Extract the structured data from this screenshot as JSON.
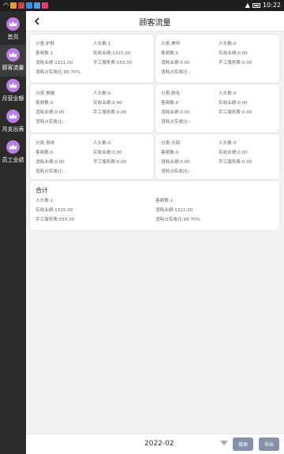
{
  "status_bar": {
    "time": "10:22"
  },
  "sidebar": {
    "items": [
      {
        "label": "首页"
      },
      {
        "label": "顾客流量",
        "active": true
      },
      {
        "label": "月营业额"
      },
      {
        "label": "月支出表"
      },
      {
        "label": "员工业绩"
      }
    ]
  },
  "header": {
    "title": "顾客流量"
  },
  "cards": [
    {
      "col1": [
        "分类:护肤",
        "客频数:1",
        "消耗业绩:1311.00",
        "消耗占实收比:99.70%"
      ],
      "col2": [
        "人头数:1",
        "实收业绩:1315.00",
        "手工服务费:555.00"
      ]
    },
    {
      "col1": [
        "分类:美甲",
        "客频数:0",
        "消耗业绩:0.00",
        "消耗占实收比:-"
      ],
      "col2": [
        "人头数:0",
        "实收业绩:0.00",
        "手工服务费:0.00"
      ]
    },
    {
      "col1": [
        "分类:美睫",
        "客频数:0",
        "消耗业绩:0.00",
        "消耗占实收比:-"
      ],
      "col2": [
        "人头数:0",
        "实收业绩:0.00",
        "手工服务费:0.00"
      ]
    },
    {
      "col1": [
        "分类:脱毛",
        "客频数:0",
        "消耗业绩:0.00",
        "消耗占实收比:-"
      ],
      "col2": [
        "人头数:0",
        "实收业绩:0.00",
        "手工服务费:0.00"
      ]
    },
    {
      "col1": [
        "分类:身体",
        "客频数:0",
        "消耗业绩:0.00",
        "消耗占实收比:-"
      ],
      "col2": [
        "人头数:0",
        "实收业绩:0.00",
        "手工服务费:0.00"
      ]
    },
    {
      "col1": [
        "分类:头部",
        "客频数:0",
        "消耗业绩:0.00",
        "消耗占实收比:-"
      ],
      "col2": [
        "人头数:0",
        "实收业绩:0.00",
        "手工服务费:0.00"
      ]
    }
  ],
  "total": {
    "title": "合计",
    "col1": [
      "人头数:1",
      "实收业绩:1315.00",
      "手工服务费:555.00"
    ],
    "col2": [
      "客频数:1",
      "消耗业绩:1311.00",
      "消耗占实收比:99.70%"
    ]
  },
  "footer": {
    "date": "2022-02",
    "search_label": "搜索",
    "export_label": "导出"
  },
  "colors": {
    "accent": "#b97fe0",
    "sidebar_bg": "#2b2b2b",
    "button_bg": "#8591aa"
  }
}
